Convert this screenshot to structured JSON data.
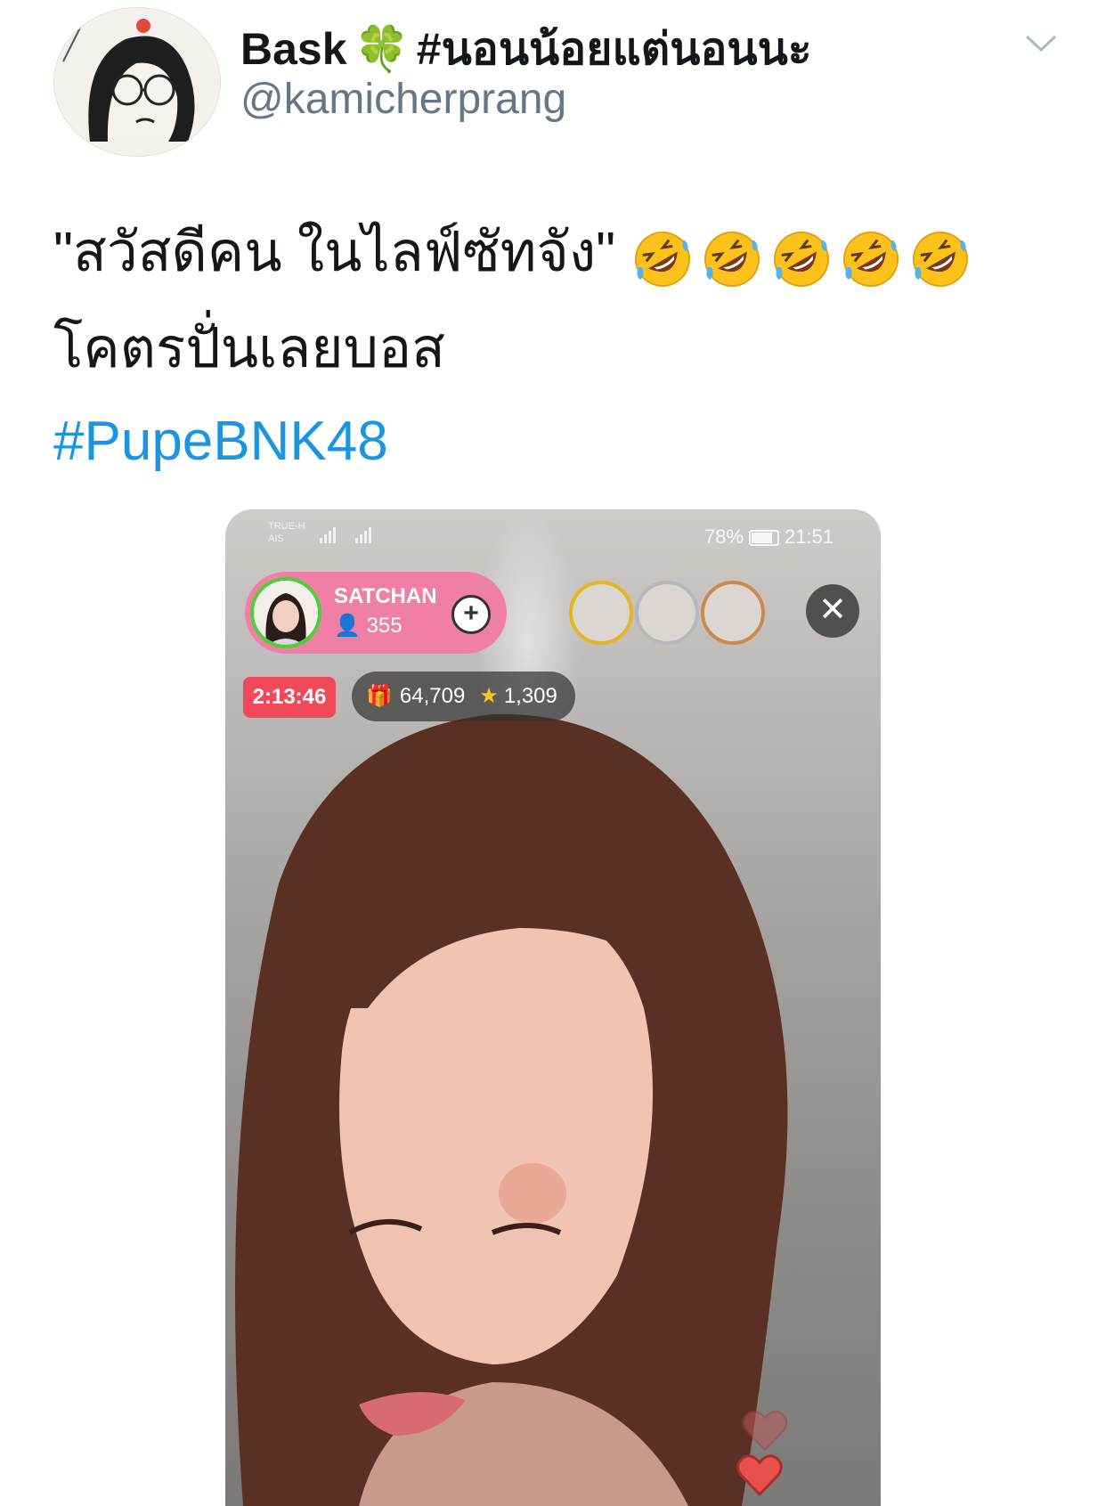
{
  "header": {
    "display_name": "Bask",
    "clover_emoji": "🍀",
    "name_hashtag": "#นอนน้อยแต่นอนนะ",
    "handle": "@kamicherprang"
  },
  "tweet": {
    "line1": "\"สวัสดีคน ในไลฟ์ซัทจัง\"",
    "emoji_count": 5,
    "emoji_name": "rolling-on-floor-laughing",
    "line2": "โคตรปั่นเลยบอส",
    "hashtag": "#PupeBNK48"
  },
  "media": {
    "status": {
      "carrier1": "TRUE-H",
      "carrier2": "AIS",
      "battery": "78%",
      "time": "21:51"
    },
    "host": {
      "name": "SATCHAN",
      "viewers": "355"
    },
    "top_fans": [
      "1",
      "2",
      "3"
    ],
    "timer": "2:13:46",
    "gifts": "64,709",
    "stars": "1,309"
  },
  "colors": {
    "link": "#1b95e0",
    "handle": "#657786",
    "host_pill": "#ef7fa4",
    "timer": "#f04a5a"
  }
}
